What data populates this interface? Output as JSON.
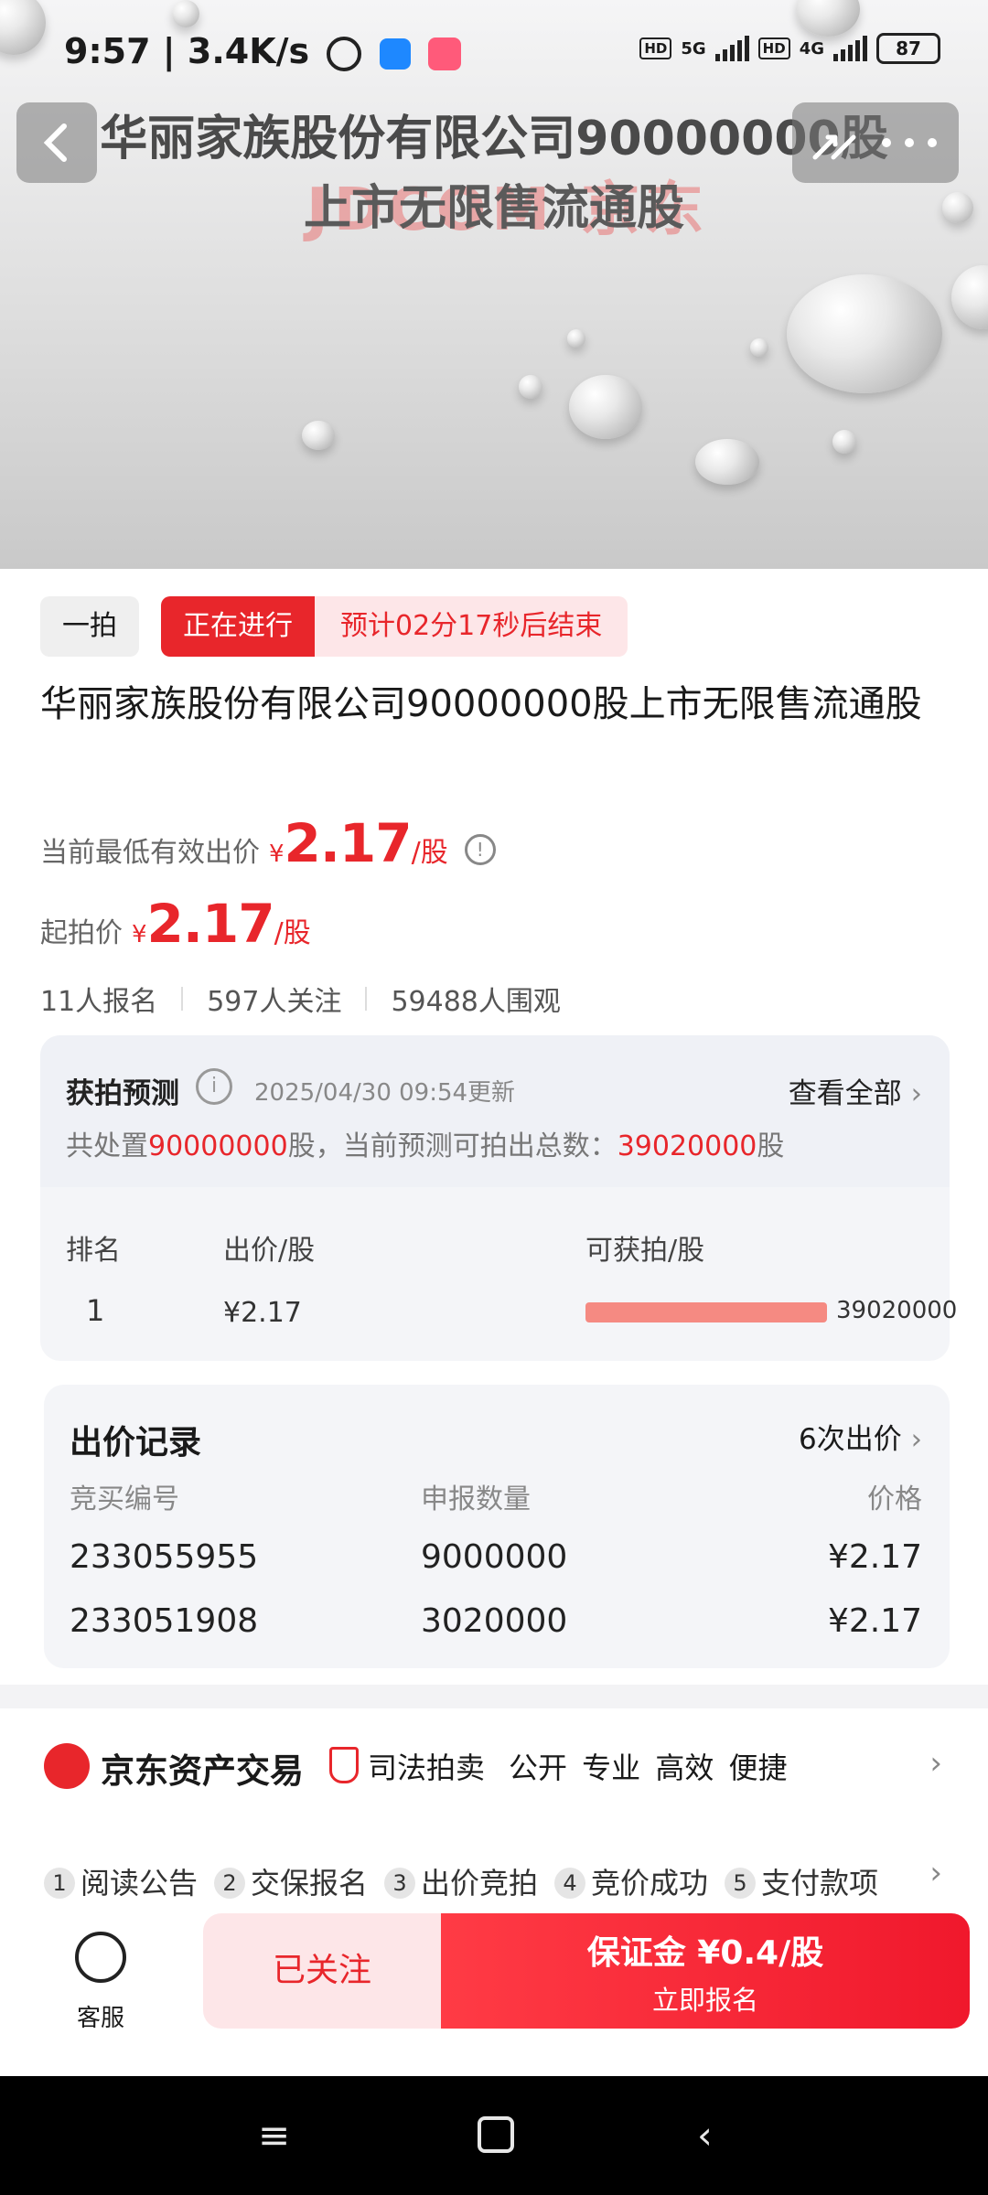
{
  "status_bar": {
    "time": "9:57",
    "speed": "3.4K/s",
    "signal1": "5G",
    "signal2": "4G",
    "hd": "HD",
    "battery": "87"
  },
  "hero": {
    "title_line1": "华丽家族股份有限公司90000000股",
    "title_line2": "上市无限售流通股",
    "watermark": "JDCOM 京东"
  },
  "header": {
    "back_icon": "chevron-left-icon",
    "share_icon": "share-icon",
    "more_icon": "more-icon"
  },
  "auction": {
    "tag_round": "一拍",
    "tag_status": "正在进行",
    "countdown": "预计02分17秒后结束",
    "title": "华丽家族股份有限公司90000000股上市无限售流通股",
    "lowest_label": "当前最低有效出价",
    "currency": "¥",
    "lowest_price": "2.17",
    "unit": "/股",
    "start_label": "起拍价",
    "start_price": "2.17",
    "signups": "11人报名",
    "followers": "597人关注",
    "viewers": "59488人围观"
  },
  "prediction": {
    "heading": "获拍预测",
    "updated": "2025/04/30 09:54更新",
    "view_all": "查看全部",
    "line_prefix": "共处置",
    "total": "90000000",
    "line_mid": "股，当前预测可拍出总数：",
    "predicted": "39020000",
    "line_suffix": "股",
    "col_rank": "排名",
    "col_price": "出价/股",
    "col_qty": "可获拍/股",
    "rows": [
      {
        "rank": "1",
        "price": "¥2.17",
        "qty": "39020000",
        "fill": 1.0
      }
    ]
  },
  "records": {
    "heading": "出价记录",
    "count": "6次出价",
    "col_id": "竞买编号",
    "col_qty": "申报数量",
    "col_price": "价格",
    "rows": [
      {
        "id": "233055955",
        "qty": "9000000",
        "price": "¥2.17",
        "highlight": true
      },
      {
        "id": "233051908",
        "qty": "3020000",
        "price": "¥2.17",
        "highlight": false
      }
    ]
  },
  "brand": {
    "name": "京东资产交易",
    "judicial": "司法拍卖",
    "slogan": "公开 专业 高效 便捷"
  },
  "steps": [
    {
      "num": "1",
      "label": "阅读公告"
    },
    {
      "num": "2",
      "label": "交保报名"
    },
    {
      "num": "3",
      "label": "出价竞拍"
    },
    {
      "num": "4",
      "label": "竞价成功"
    },
    {
      "num": "5",
      "label": "支付款项"
    }
  ],
  "actions": {
    "service": "客服",
    "follow": "已关注",
    "deposit": "保证金 ¥0.4/股",
    "signup": "立即报名"
  },
  "colors": {
    "accent": "#e8262b",
    "bar": "#f58a82"
  }
}
